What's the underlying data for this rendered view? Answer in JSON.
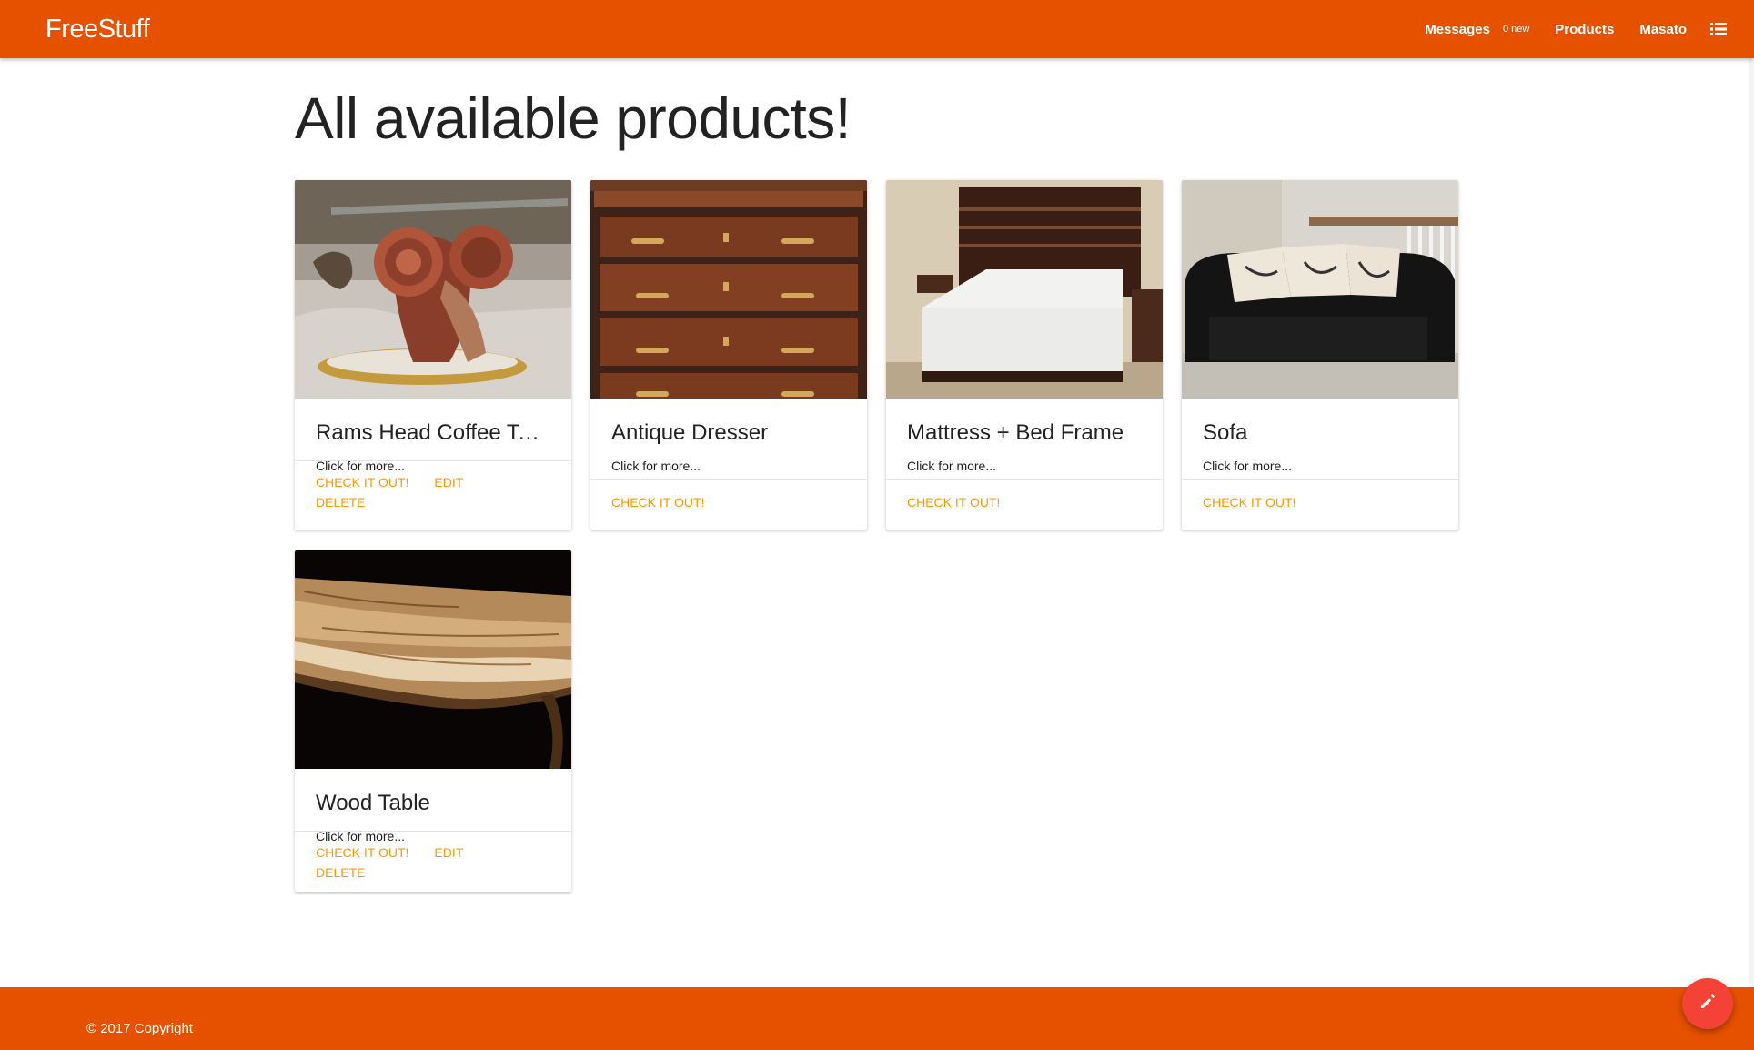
{
  "navbar": {
    "brand": "FreeStuff",
    "messages_label": "Messages",
    "messages_badge": "0 new",
    "products_label": "Products",
    "user_label": "Masato",
    "menu_icon": "list-icon"
  },
  "page": {
    "title": "All available products!"
  },
  "products": [
    {
      "title": "Rams Head Coffee Table",
      "description": "Click for more...",
      "primary_action": "Check it out!",
      "edit_action": "Edit",
      "delete_action": "Delete",
      "image": "rams-head-table-photo"
    },
    {
      "title": "Antique Dresser",
      "description": "Click for more...",
      "primary_action": "Check it out!",
      "image": "antique-dresser-photo"
    },
    {
      "title": "Mattress + Bed Frame",
      "description": "Click for more...",
      "primary_action": "Check it out!",
      "image": "bed-photo"
    },
    {
      "title": "Sofa",
      "description": "Click for more...",
      "primary_action": "Check it out!",
      "image": "sofa-photo"
    },
    {
      "title": "Wood Table",
      "description": "Click for more...",
      "primary_action": "Check it out!",
      "edit_action": "Edit",
      "delete_action": "Delete",
      "image": "wood-table-photo"
    }
  ],
  "footer": {
    "copyright": "© 2017 Copyright"
  },
  "fab": {
    "icon": "pencil-icon"
  },
  "colors": {
    "primary": "#e65100",
    "accent": "#ff9800",
    "fab": "#f44336"
  }
}
